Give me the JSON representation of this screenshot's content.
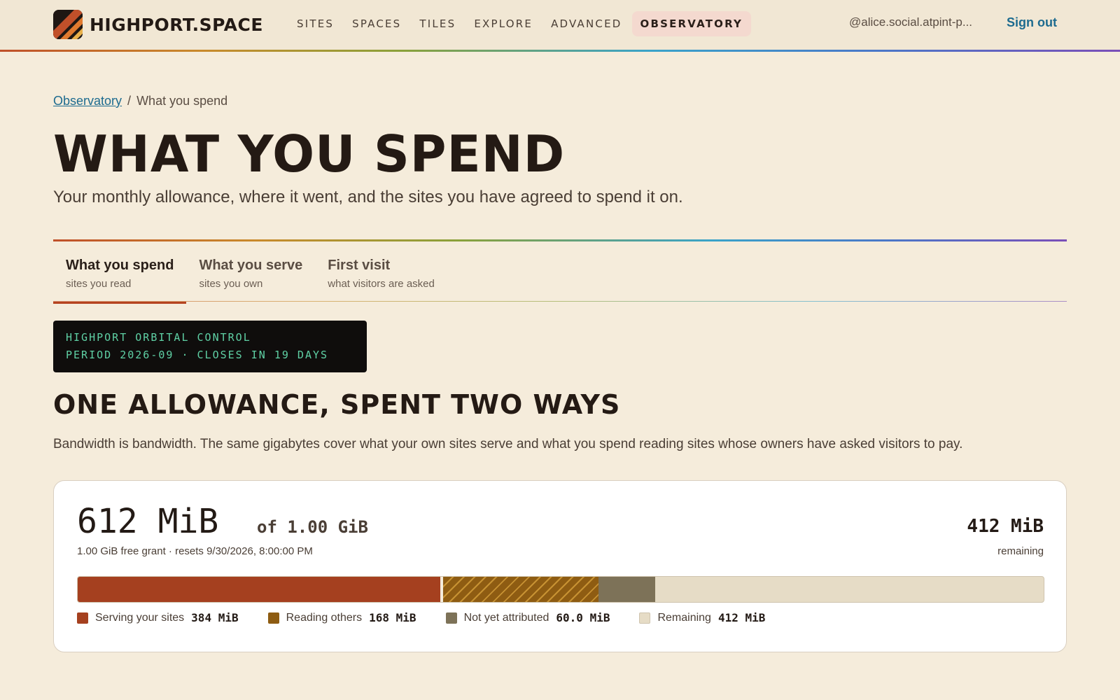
{
  "header": {
    "brand": "HIGHPORT.SPACE",
    "nav": [
      "SITES",
      "SPACES",
      "TILES",
      "EXPLORE",
      "ADVANCED",
      "OBSERVATORY"
    ],
    "active_nav": "OBSERVATORY",
    "user_handle": "@alice.social.atpint-p...",
    "sign_out": "Sign out"
  },
  "breadcrumb": {
    "parent": "Observatory",
    "separator": "/",
    "current": "What you spend"
  },
  "page": {
    "title": "WHAT YOU SPEND",
    "subtitle": "Your monthly allowance, where it went, and the sites you have agreed to spend it on."
  },
  "tabs": [
    {
      "label": "What you spend",
      "sub": "sites you read",
      "active": true
    },
    {
      "label": "What you serve",
      "sub": "sites you own",
      "active": false
    },
    {
      "label": "First visit",
      "sub": "what visitors are asked",
      "active": false
    }
  ],
  "terminal": {
    "line1": "HIGHPORT ORBITAL CONTROL",
    "line2": "PERIOD 2026-09 · CLOSES IN 19 DAYS"
  },
  "section": {
    "title": "ONE ALLOWANCE, SPENT TWO WAYS",
    "description": "Bandwidth is bandwidth. The same gigabytes cover what your own sites serve and what you spend reading sites whose owners have asked visitors to pay."
  },
  "usage": {
    "used": "612 MiB",
    "of_total": "of 1.00 GiB",
    "grant_note": "1.00 GiB free grant · resets 9/30/2026, 8:00:00 PM",
    "remaining_value": "412 MiB",
    "remaining_label": "remaining",
    "total_mib": 1024,
    "segments": [
      {
        "key": "serving",
        "label": "Serving your sites",
        "value_text": "384 MiB",
        "mib": 384,
        "color": "#a5401f"
      },
      {
        "key": "reading",
        "label": "Reading others",
        "value_text": "168 MiB",
        "mib": 168,
        "color": "#8e5c12"
      },
      {
        "key": "unattr",
        "label": "Not yet attributed",
        "value_text": "60.0 MiB",
        "mib": 60,
        "color": "#7d7258"
      },
      {
        "key": "remaining",
        "label": "Remaining",
        "value_text": "412 MiB",
        "mib": 412,
        "color": "#e6dcc6"
      }
    ]
  }
}
